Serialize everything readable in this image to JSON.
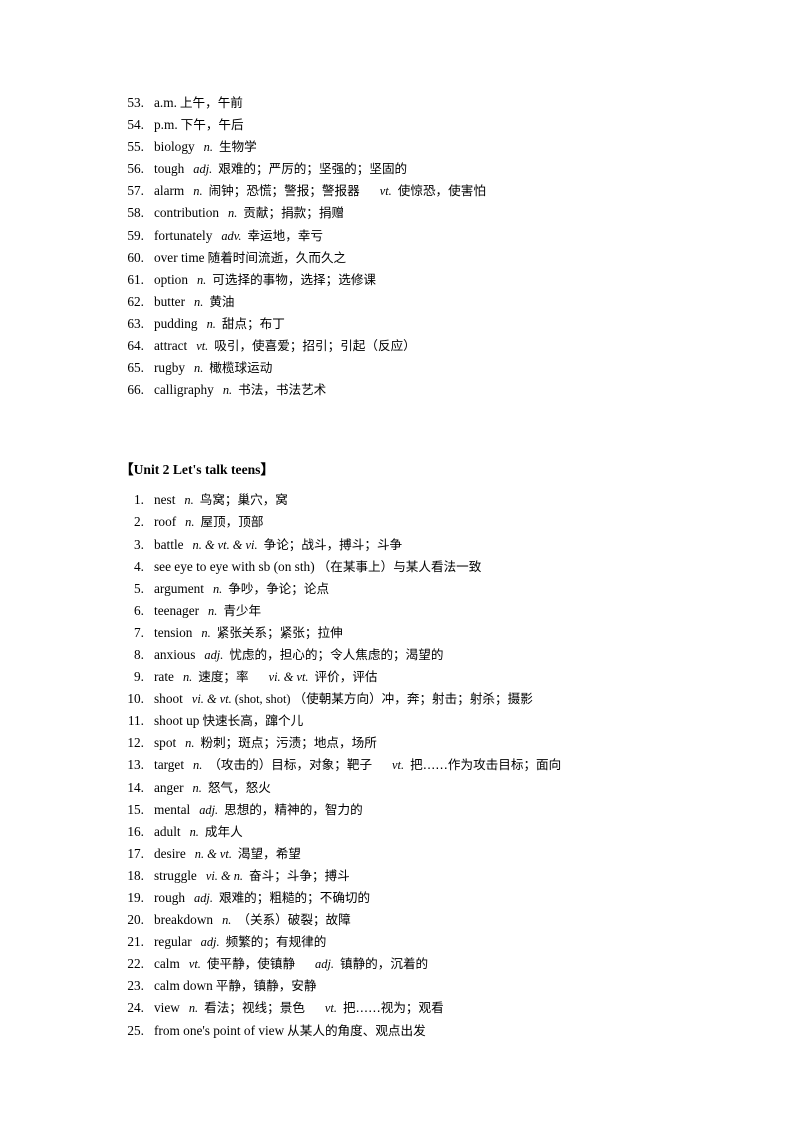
{
  "document": {
    "type": "vocabulary-list",
    "language_pair": "English-Chinese"
  },
  "section_one": {
    "continued": true,
    "items": [
      {
        "num": "53.",
        "word": "a.m.",
        "pos": "",
        "cn": "上午，午前"
      },
      {
        "num": "54.",
        "word": "p.m.",
        "pos": "",
        "cn": "下午，午后"
      },
      {
        "num": "55.",
        "word": "biology",
        "pos": "n.",
        "cn": "生物学"
      },
      {
        "num": "56.",
        "word": "tough",
        "pos": "adj.",
        "cn": "艰难的；严厉的；坚强的；坚固的"
      },
      {
        "num": "57.",
        "word": "alarm",
        "pos": "n.",
        "cn": "闹钟；恐慌；警报；警报器",
        "pos2": "vt.",
        "cn2": "使惊恐，使害怕"
      },
      {
        "num": "58.",
        "word": "contribution",
        "pos": "n.",
        "cn": "贡献；捐款；捐赠"
      },
      {
        "num": "59.",
        "word": "fortunately",
        "pos": "adv.",
        "cn": "幸运地，幸亏"
      },
      {
        "num": "60.",
        "word": "over time",
        "pos": "",
        "cn": "随着时间流逝，久而久之"
      },
      {
        "num": "61.",
        "word": "option",
        "pos": "n.",
        "cn": "可选择的事物，选择；选修课"
      },
      {
        "num": "62.",
        "word": "butter",
        "pos": "n.",
        "cn": "黄油"
      },
      {
        "num": "63.",
        "word": "pudding",
        "pos": "n.",
        "cn": "甜点；布丁"
      },
      {
        "num": "64.",
        "word": "attract",
        "pos": "vt.",
        "cn": "吸引，使喜爱；招引；引起（反应）"
      },
      {
        "num": "65.",
        "word": "rugby",
        "pos": "n.",
        "cn": "橄榄球运动"
      },
      {
        "num": "66.",
        "word": "calligraphy",
        "pos": "n.",
        "cn": "书法，书法艺术"
      }
    ]
  },
  "section_two": {
    "heading": "【Unit 2 Let's talk teens】",
    "heading_bracket_open": "【",
    "heading_text": "Unit 2 Let's talk teens",
    "heading_bracket_close": "】",
    "items": [
      {
        "num": "1.",
        "word": "nest",
        "pos": "n.",
        "cn": "鸟窝；巢穴，窝"
      },
      {
        "num": "2.",
        "word": "roof",
        "pos": "n.",
        "cn": "屋顶，顶部"
      },
      {
        "num": "3.",
        "word": "battle",
        "pos": "n. & vt. & vi.",
        "cn": "争论；战斗，搏斗；斗争"
      },
      {
        "num": "4.",
        "word": "see eye to eye with sb (on sth)",
        "pos": "",
        "cn": "（在某事上）与某人看法一致"
      },
      {
        "num": "5.",
        "word": "argument",
        "pos": "n.",
        "cn": "争吵，争论；论点"
      },
      {
        "num": "6.",
        "word": "teenager",
        "pos": "n.",
        "cn": "青少年"
      },
      {
        "num": "7.",
        "word": "tension",
        "pos": "n.",
        "cn": "紧张关系；紧张；拉伸"
      },
      {
        "num": "8.",
        "word": "anxious",
        "pos": "adj.",
        "cn": "忧虑的，担心的；令人焦虑的；渴望的"
      },
      {
        "num": "9.",
        "word": "rate",
        "pos": "n.",
        "cn": "速度；率",
        "pos2": "vi. & vt.",
        "cn2": "评价，评估"
      },
      {
        "num": "10.",
        "word": "shoot",
        "pos": "vi. & vt.",
        "pos_plain": "(shot, shot)",
        "cn": "（使朝某方向）冲，奔；射击；射杀；摄影"
      },
      {
        "num": "11.",
        "word": "shoot up",
        "pos": "",
        "cn": "快速长高，蹿个儿"
      },
      {
        "num": "12.",
        "word": "spot",
        "pos": "n.",
        "cn": "粉刺；斑点；污渍；地点，场所"
      },
      {
        "num": "13.",
        "word": "target",
        "pos": "n.",
        "cn": "（攻击的）目标，对象；靶子",
        "pos2": "vt.",
        "cn2": "把……作为攻击目标；面向"
      },
      {
        "num": "14.",
        "word": "anger",
        "pos": "n.",
        "cn": "怒气，怒火"
      },
      {
        "num": "15.",
        "word": "mental",
        "pos": "adj.",
        "cn": "思想的，精神的，智力的"
      },
      {
        "num": "16.",
        "word": "adult",
        "pos": "n.",
        "cn": "成年人"
      },
      {
        "num": "17.",
        "word": "desire",
        "pos": "n. & vt.",
        "cn": "渴望，希望"
      },
      {
        "num": "18.",
        "word": "struggle",
        "pos": "vi. & n.",
        "cn": "奋斗；斗争；搏斗"
      },
      {
        "num": "19.",
        "word": "rough",
        "pos": "adj.",
        "cn": "艰难的；粗糙的；不确切的"
      },
      {
        "num": "20.",
        "word": "breakdown",
        "pos": "n.",
        "cn": "（关系）破裂；故障"
      },
      {
        "num": "21.",
        "word": "regular",
        "pos": "adj.",
        "cn": "频繁的；有规律的"
      },
      {
        "num": "22.",
        "word": "calm",
        "pos": "vt.",
        "cn": "使平静，使镇静",
        "pos2": "adj.",
        "cn2": "镇静的，沉着的"
      },
      {
        "num": "23.",
        "word": "calm down",
        "pos": "",
        "cn": "平静，镇静，安静"
      },
      {
        "num": "24.",
        "word": "view",
        "pos": "n.",
        "cn": "看法；视线；景色",
        "pos2": "vt.",
        "cn2": "把……视为；观看"
      },
      {
        "num": "25.",
        "word": "from one's point of view",
        "pos": "",
        "cn": "从某人的角度、观点出发"
      }
    ]
  }
}
